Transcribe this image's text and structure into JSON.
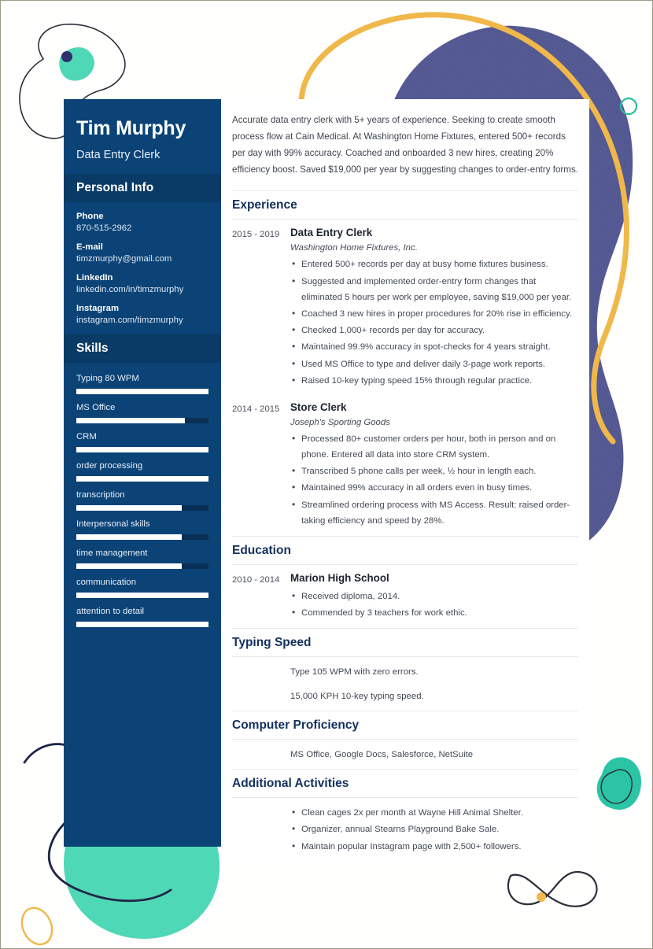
{
  "theme": {
    "sidebar_bg": "#0b4377",
    "sidebar_band_bg": "#0a3a66",
    "heading_color": "#14305c",
    "accent_teal": "#3fd3b0",
    "accent_gold": "#f0b84a",
    "accent_navy_blob": "#4b4f8f",
    "page_bg": "#fffffe"
  },
  "sidebar": {
    "name": "Tim Murphy",
    "job_title": "Data Entry Clerk",
    "personal_info": {
      "heading": "Personal Info",
      "items": [
        {
          "label": "Phone",
          "value": "870-515-2962"
        },
        {
          "label": "E-mail",
          "value": "timzmurphy@gmail.com"
        },
        {
          "label": "LinkedIn",
          "value": "linkedin.com/in/timzmurphy"
        },
        {
          "label": "Instagram",
          "value": "instagram.com/timzmurphy"
        }
      ]
    },
    "skills": {
      "heading": "Skills",
      "items": [
        {
          "label": "Typing 80 WPM",
          "level": 100
        },
        {
          "label": "MS Office",
          "level": 82
        },
        {
          "label": "CRM",
          "level": 100
        },
        {
          "label": "order processing",
          "level": 100
        },
        {
          "label": "transcription",
          "level": 80
        },
        {
          "label": "Interpersonal skills",
          "level": 80
        },
        {
          "label": "time management",
          "level": 80
        },
        {
          "label": "communication",
          "level": 100
        },
        {
          "label": "attention to detail",
          "level": 100
        }
      ]
    }
  },
  "main": {
    "summary": "Accurate data entry clerk with 5+ years of experience. Seeking to create smooth process flow at Cain Medical. At Washington Home Fixtures, entered 500+ records per day with 99% accuracy. Coached and onboarded 3 new hires, creating 20% efficiency boost. Saved $19,000 per year by suggesting changes to order-entry forms.",
    "experience": {
      "heading": "Experience",
      "entries": [
        {
          "date": "2015 - 2019",
          "role": "Data Entry Clerk",
          "org": "Washington Home Fixtures, Inc.",
          "bullets": [
            "Entered 500+ records per day at busy home fixtures business.",
            "Suggested and implemented order-entry form changes that eliminated 5 hours per work per employee, saving $19,000 per year.",
            "Coached 3 new hires in proper procedures for 20% rise in efficiency.",
            "Checked 1,000+ records per day for accuracy.",
            "Maintained 99.9% accuracy in spot-checks for 4 years straight.",
            "Used MS Office to type and deliver daily 3-page work reports.",
            "Raised 10-key typing speed 15% through regular practice."
          ]
        },
        {
          "date": "2014 - 2015",
          "role": "Store Clerk",
          "org": "Joseph's Sporting Goods",
          "bullets": [
            "Processed 80+ customer orders per hour, both in person and on phone. Entered all data into store CRM system.",
            "Transcribed 5 phone calls per week, ½ hour in length each.",
            "Maintained 99% accuracy in all orders even in busy times.",
            "Streamlined ordering process with MS Access. Result: raised order-taking efficiency and speed by 28%."
          ]
        }
      ]
    },
    "education": {
      "heading": "Education",
      "entries": [
        {
          "date": "2010 - 2014",
          "role": "Marion High School",
          "org": "",
          "bullets": [
            "Received diploma, 2014.",
            "Commended by 3 teachers for work ethic."
          ]
        }
      ]
    },
    "typing_speed": {
      "heading": "Typing Speed",
      "lines": [
        "Type 105 WPM with zero errors.",
        "15,000 KPH 10-key typing speed."
      ]
    },
    "computer_proficiency": {
      "heading": "Computer Proficiency",
      "lines": [
        "MS Office, Google Docs, Salesforce, NetSuite"
      ]
    },
    "additional_activities": {
      "heading": "Additional Activities",
      "bullets": [
        "Clean cages 2x per month at Wayne Hill Animal Shelter.",
        "Organizer, annual Stearns Playground Bake Sale.",
        "Maintain popular Instagram page with 2,500+ followers."
      ]
    }
  }
}
